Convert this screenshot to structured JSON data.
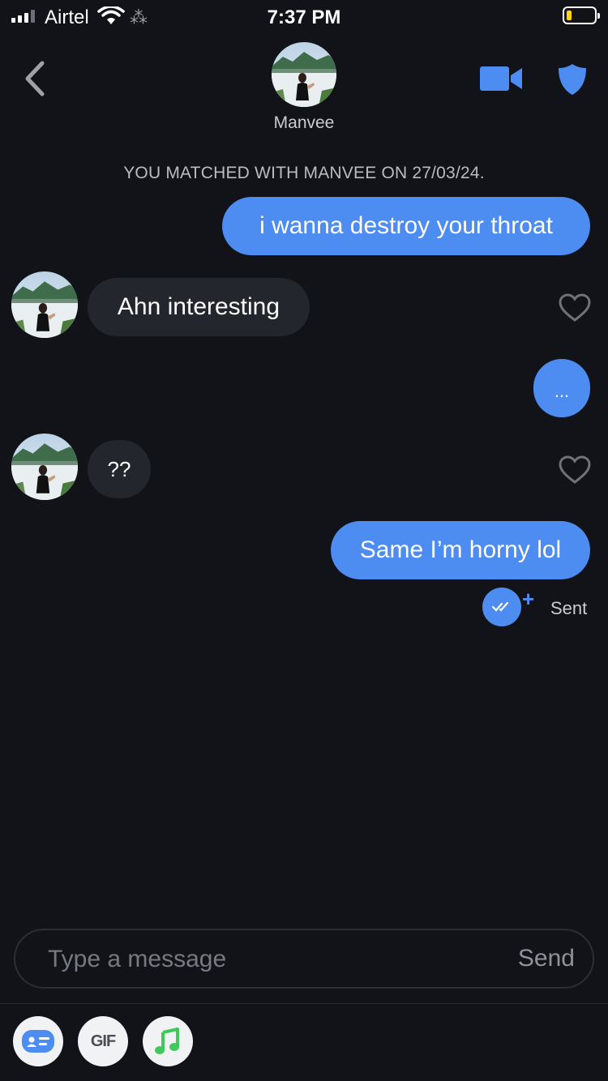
{
  "status_bar": {
    "carrier": "Airtel",
    "time": "7:37 PM",
    "spinner": "⁂"
  },
  "header": {
    "name": "Manvee"
  },
  "match_line": "YOU MATCHED WITH MANVEE ON 27/03/24.",
  "messages": [
    {
      "side": "out",
      "text": "i wanna destroy your throat"
    },
    {
      "side": "in",
      "text": "Ahn interesting"
    },
    {
      "side": "out",
      "text": "..."
    },
    {
      "side": "in",
      "text": "??"
    },
    {
      "side": "out",
      "text": "Same I’m horny lol"
    }
  ],
  "receipt": {
    "plus": "+",
    "status": "Sent"
  },
  "composer": {
    "placeholder": "Type a message",
    "send_label": "Send"
  },
  "tools": {
    "gif_label": "GIF"
  },
  "colors": {
    "accent": "#4d8cf0",
    "background": "#111318",
    "incoming_bubble": "#23262d",
    "music_green": "#3ec95c"
  },
  "icons": [
    "back-chevron-icon",
    "video-camera-icon",
    "shield-icon",
    "heart-icon",
    "double-check-icon",
    "id-card-icon",
    "music-note-icon"
  ]
}
